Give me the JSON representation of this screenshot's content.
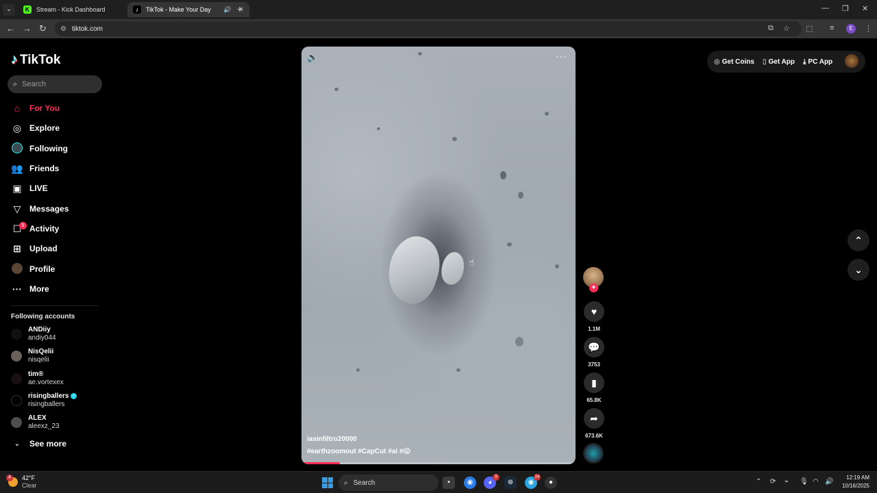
{
  "browser": {
    "tabs": [
      {
        "title": "Stream - Kick Dashboard",
        "favicon": "K"
      },
      {
        "title": "TikTok - Make Your Day",
        "favicon": "♪"
      }
    ],
    "url": "tiktok.com",
    "profile_initial": "E"
  },
  "tiktok": {
    "logo_text": "TikTok",
    "search_placeholder": "Search",
    "nav": [
      {
        "label": "For You",
        "icon": "home-icon"
      },
      {
        "label": "Explore",
        "icon": "compass-icon"
      },
      {
        "label": "Following",
        "icon": "following-avatar-icon"
      },
      {
        "label": "Friends",
        "icon": "friends-icon"
      },
      {
        "label": "LIVE",
        "icon": "live-icon"
      },
      {
        "label": "Messages",
        "icon": "messages-icon"
      },
      {
        "label": "Activity",
        "icon": "activity-icon",
        "badge": "5"
      },
      {
        "label": "Upload",
        "icon": "upload-icon"
      },
      {
        "label": "Profile",
        "icon": "profile-avatar-icon"
      },
      {
        "label": "More",
        "icon": "more-icon"
      }
    ],
    "following_title": "Following accounts",
    "following": [
      {
        "name": "ANDiiy",
        "handle": "andiy044",
        "verified": false
      },
      {
        "name": "NisQelii",
        "handle": "nisqelii",
        "verified": false
      },
      {
        "name": "tim®",
        "handle": "ae.vortexex",
        "verified": false
      },
      {
        "name": "risingballers",
        "handle": "risingballers",
        "verified": true
      },
      {
        "name": "ALEX",
        "handle": "aleexz_23",
        "verified": false
      }
    ],
    "see_more": "See more",
    "video": {
      "username": "iasinfiltro20000",
      "tags": "#earthzoomout  #CapCut  #ai  #😱",
      "progress": 0.14
    },
    "actions": {
      "likes": "1.1M",
      "comments": "3753",
      "saves": "65.8K",
      "shares": "673.6K"
    },
    "top_right": {
      "get_coins": "Get Coins",
      "get_app": "Get App",
      "pc_app": "PC App"
    }
  },
  "taskbar": {
    "temp": "42°F",
    "condition": "Clear",
    "weather_badge": "4",
    "search": "Search",
    "time": "12:19 AM",
    "date": "10/16/2025"
  },
  "colors": {
    "accent": "#fe2c55",
    "verified": "#20d5ec"
  }
}
